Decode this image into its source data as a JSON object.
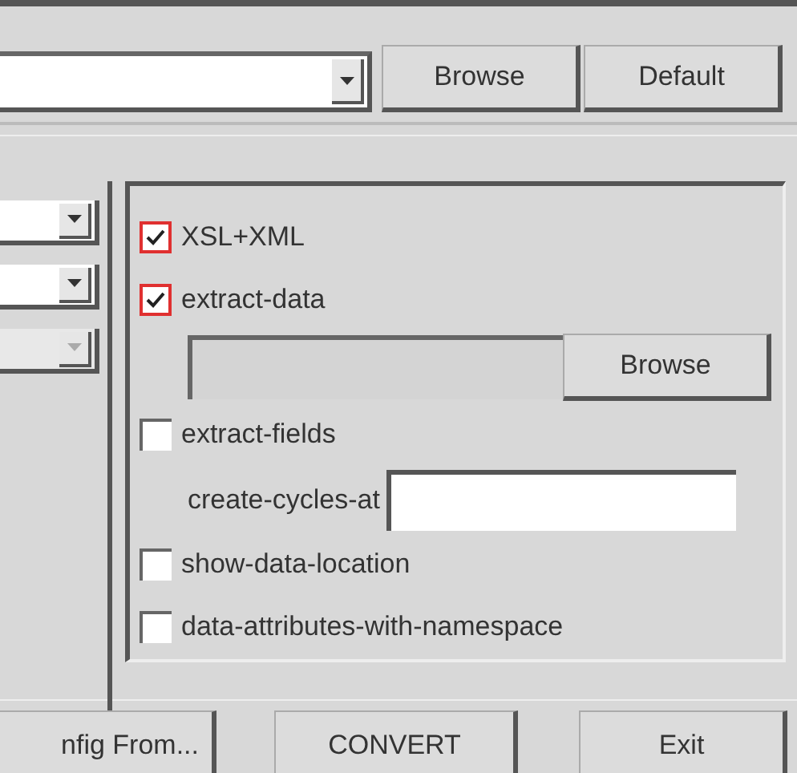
{
  "top": {
    "buttons": [
      "Browse",
      "Default"
    ]
  },
  "left_combos": [
    {
      "disabled": false
    },
    {
      "disabled": false
    },
    {
      "disabled": true
    }
  ],
  "options": [
    {
      "kind": "checkbox",
      "label": "XSL+XML",
      "checked": true
    },
    {
      "kind": "checkbox",
      "label": "extract-data",
      "checked": true
    },
    {
      "kind": "file_row",
      "button": "Browse"
    },
    {
      "kind": "checkbox",
      "label": "extract-fields",
      "checked": false
    },
    {
      "kind": "text_row",
      "label": "create-cycles-at"
    },
    {
      "kind": "checkbox",
      "label": "show-data-location",
      "checked": false
    },
    {
      "kind": "checkbox",
      "label": "data-attributes-with-namespace",
      "checked": false
    }
  ],
  "bottom_buttons": [
    "nfig From...",
    "CONVERT",
    "Exit"
  ]
}
